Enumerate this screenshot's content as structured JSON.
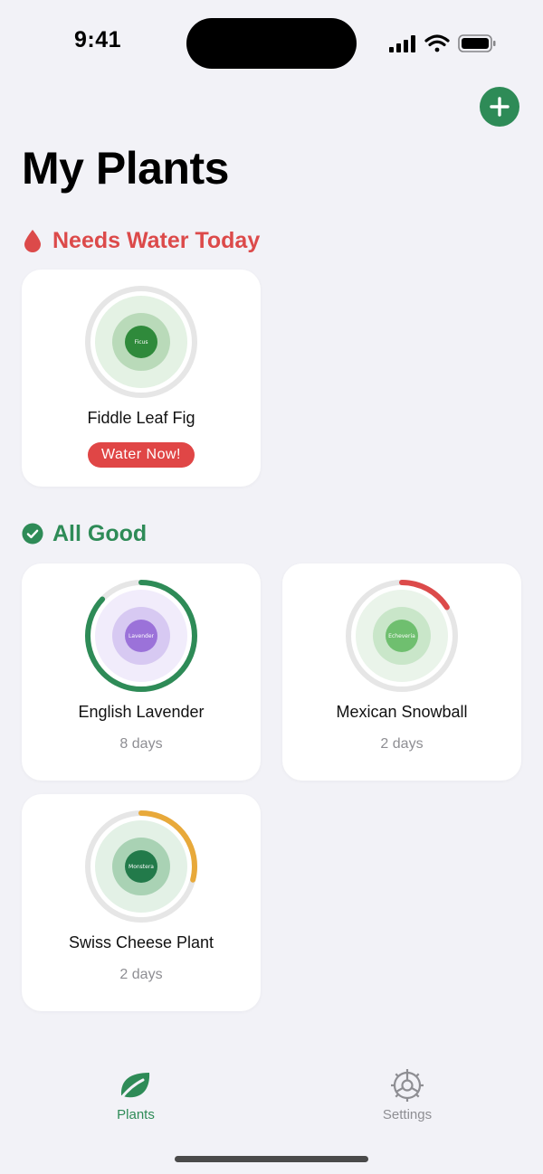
{
  "status_bar": {
    "time": "9:41"
  },
  "page": {
    "title": "My Plants"
  },
  "add_button": {
    "icon": "plus-icon"
  },
  "sections": {
    "needs_water": {
      "label": "Needs Water Today",
      "icon": "water-drop-icon",
      "color": "#dc4a4a"
    },
    "all_good": {
      "label": "All Good",
      "icon": "checkmark-circle-icon",
      "color": "#2e8b57"
    }
  },
  "plants": {
    "fig": {
      "name": "Fiddle Leaf Fig",
      "inner_label": "Ficus",
      "action_label": "Water Now!",
      "progress": 0
    },
    "lavender": {
      "name": "English Lavender",
      "inner_label": "Lavender",
      "days": "8 days",
      "progress": 0.87,
      "ring_color": "#2e8b57"
    },
    "snowball": {
      "name": "Mexican Snowball",
      "inner_label": "Echeveria",
      "days": "2 days",
      "progress": 0.16,
      "ring_color": "#dc4a4a"
    },
    "monstera": {
      "name": "Swiss Cheese Plant",
      "inner_label": "Monstera",
      "days": "2 days",
      "progress": 0.29,
      "ring_color": "#e8a93a"
    }
  },
  "tab_bar": {
    "plants_label": "Plants",
    "settings_label": "Settings",
    "active": "Plants",
    "accent": "#2e8b57"
  }
}
